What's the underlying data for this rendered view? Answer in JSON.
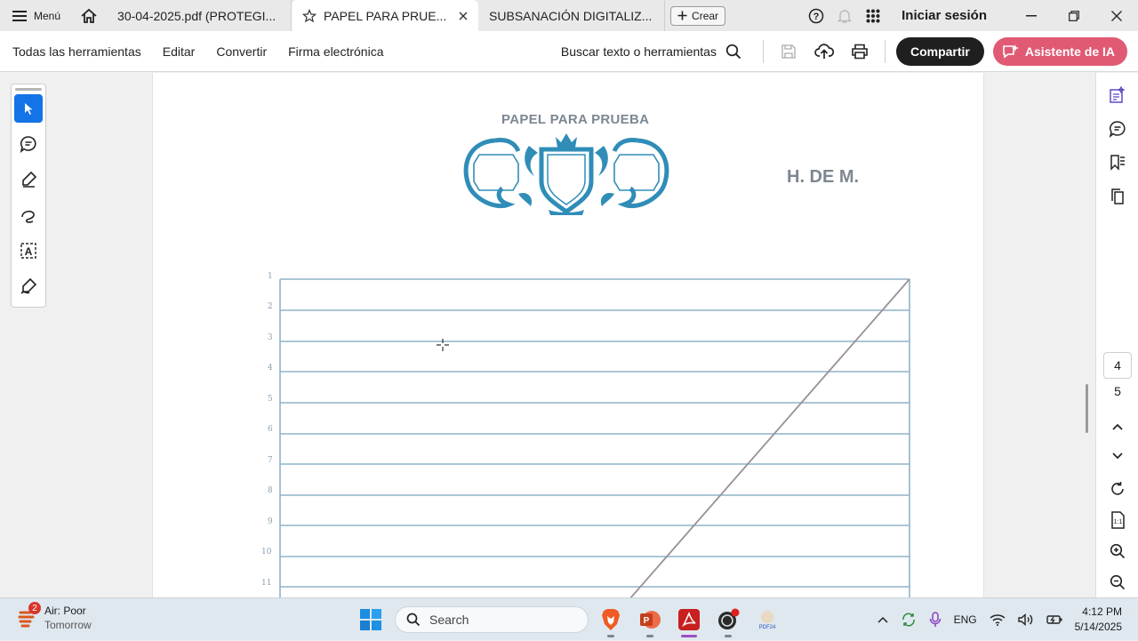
{
  "titlebar": {
    "menu_label": "Menú",
    "tabs": [
      {
        "label": "30-04-2025.pdf (PROTEGI..."
      },
      {
        "label": "PAPEL PARA PRUE...",
        "active": true
      },
      {
        "label": "SUBSANACIÓN DIGITALIZ..."
      }
    ],
    "create_label": "Crear",
    "signin_label": "Iniciar sesión"
  },
  "toolbar": {
    "menus": [
      "Todas las herramientas",
      "Editar",
      "Convertir",
      "Firma electrónica"
    ],
    "search_label": "Buscar texto o herramientas",
    "share_label": "Compartir",
    "ai_label": "Asistente de IA"
  },
  "document": {
    "header_title": "PAPEL PARA PRUEBA",
    "code": "H. DE M.",
    "line_numbers": [
      "1",
      "2",
      "3",
      "4",
      "5",
      "6",
      "7",
      "8",
      "9",
      "10",
      "11"
    ]
  },
  "navigator": {
    "current_page": "4",
    "total_pages": "5"
  },
  "taskbar": {
    "weather_title": "Air: Poor",
    "weather_sub": "Tomorrow",
    "weather_badge": "2",
    "search_placeholder": "Search",
    "language": "ENG",
    "time": "4:12 PM",
    "date": "5/14/2025"
  },
  "colors": {
    "accent_blue": "#1473e6",
    "share_bg": "#1f1f1f",
    "ai_bg": "#e05a74",
    "crest_blue": "#2f8db8"
  }
}
